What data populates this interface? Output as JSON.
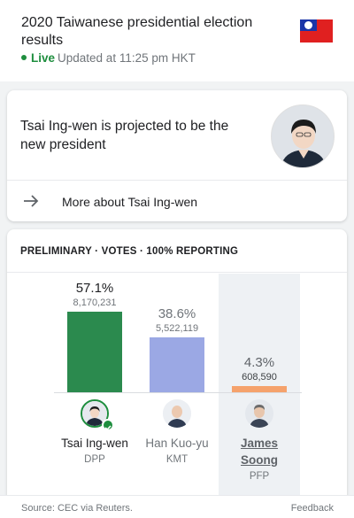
{
  "header": {
    "title": "2020 Taiwanese presidential election results",
    "live_label": "Live",
    "updated_text": "Updated at 11:25 pm HKT",
    "flag_icon": "taiwan-flag-icon"
  },
  "projection": {
    "text": "Tsai Ing-wen is projected to be the new president",
    "more_label": "More about Tsai Ing-wen"
  },
  "results": {
    "heading": "PRELIMINARY · VOTES · 100% REPORTING",
    "candidates": [
      {
        "name": "Tsai Ing-wen",
        "party": "DPP",
        "percent": "57.1%",
        "votes": "8,170,231",
        "share": 57.1,
        "color": "#2b8a4e",
        "winner": true
      },
      {
        "name": "Han Kuo-yu",
        "party": "KMT",
        "percent": "38.6%",
        "votes": "5,522,119",
        "share": 38.6,
        "color": "#9ba8e4",
        "winner": false
      },
      {
        "name": "James Soong",
        "party": "PFP",
        "percent": "4.3%",
        "votes": "608,590",
        "share": 4.3,
        "color": "#f5a26c",
        "winner": false,
        "selected": true
      }
    ]
  },
  "footer": {
    "source": "Source: CEC via Reuters.",
    "feedback": "Feedback"
  },
  "chart_data": {
    "type": "bar",
    "categories": [
      "Tsai Ing-wen",
      "Han Kuo-yu",
      "James Soong"
    ],
    "values": [
      57.1,
      38.6,
      4.3
    ],
    "votes": [
      8170231,
      5522119,
      608590
    ],
    "title": "PRELIMINARY · VOTES · 100% REPORTING",
    "colors": [
      "#2b8a4e",
      "#9ba8e4",
      "#f5a26c"
    ]
  }
}
